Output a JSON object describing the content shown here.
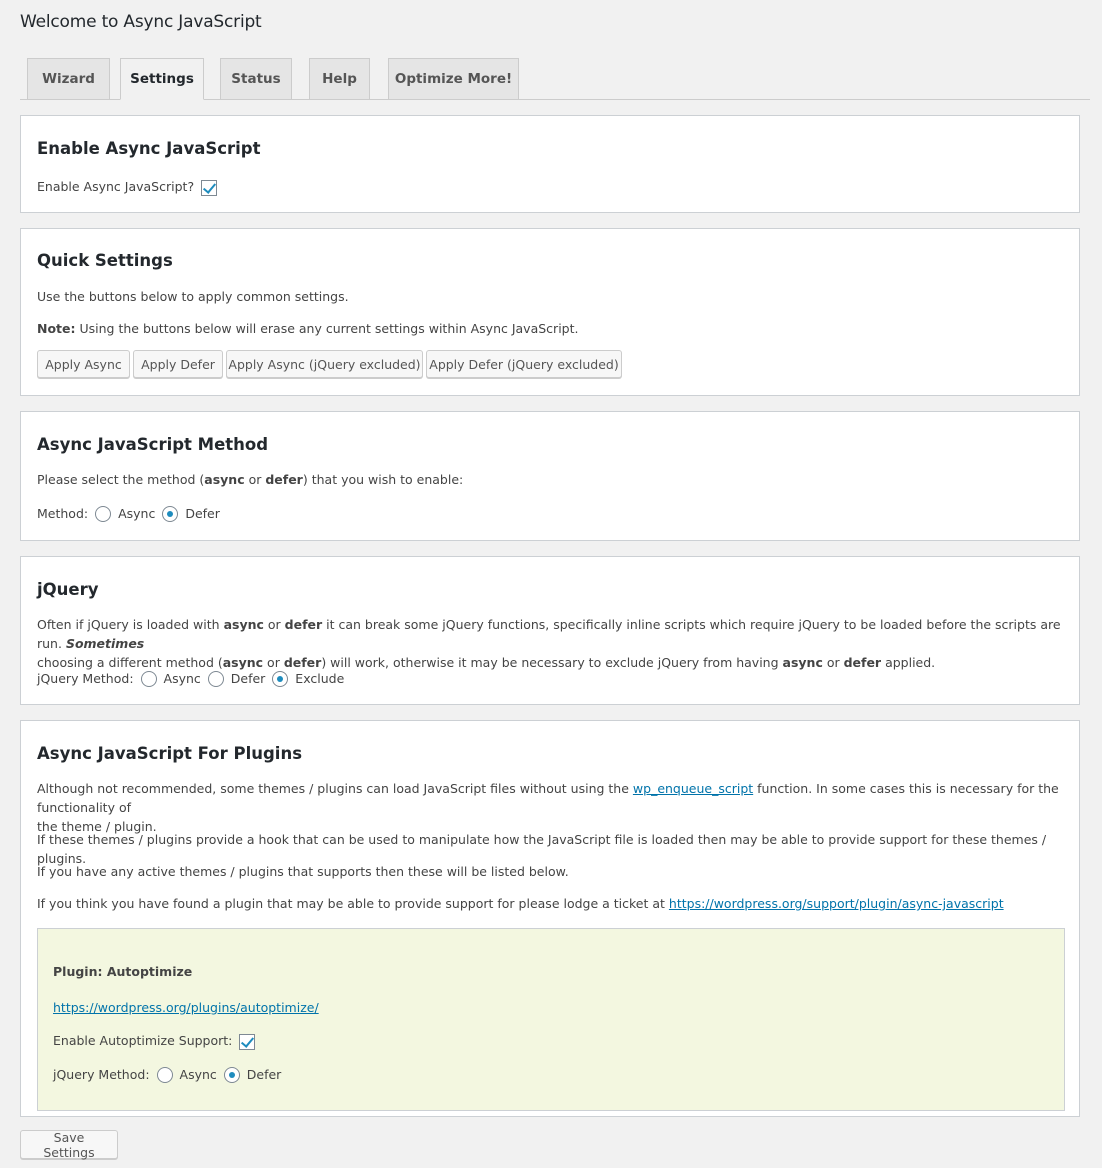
{
  "page_title": "Welcome to Async JavaScript",
  "tabs": [
    {
      "label": "Wizard",
      "active": false
    },
    {
      "label": "Settings",
      "active": true
    },
    {
      "label": "Status",
      "active": false
    },
    {
      "label": "Help",
      "active": false
    },
    {
      "label": "Optimize More!",
      "active": false
    }
  ],
  "enable_section": {
    "title": "Enable Async JavaScript",
    "checkbox_label": "Enable Async JavaScript?",
    "checked": true
  },
  "quick_settings": {
    "title": "Quick Settings",
    "intro": "Use the buttons below to apply common settings.",
    "note_label": "Note:",
    "note_text": " Using the buttons below will erase any current settings within Async JavaScript.",
    "buttons": [
      "Apply Async",
      "Apply Defer",
      "Apply Async (jQuery excluded)",
      "Apply Defer (jQuery excluded)"
    ]
  },
  "method_section": {
    "title": "Async JavaScript Method",
    "desc_pre": "Please select the method (",
    "desc_async": "async",
    "desc_or": " or ",
    "desc_defer": "defer",
    "desc_post": ") that you wish to enable:",
    "method_label": "Method:",
    "options": [
      "Async",
      "Defer"
    ],
    "selected": "Defer"
  },
  "jquery_section": {
    "title": "jQuery",
    "p1": "Often if jQuery is loaded with ",
    "p2": "async",
    "p3": " or ",
    "p4": "defer",
    "p5": " it can break some jQuery functions, specifically inline scripts which require jQuery to be loaded before the scripts are run. ",
    "p6": "Sometimes",
    "p7": "choosing a different method (",
    "p8": "async",
    "p9": " or ",
    "p10": "defer",
    "p11": ") will work, otherwise it may be necessary to exclude jQuery from having ",
    "p12": "async",
    "p13": " or ",
    "p14": "defer",
    "p15": " applied.",
    "method_label": "jQuery Method:",
    "options": [
      "Async",
      "Defer",
      "Exclude"
    ],
    "selected": "Exclude"
  },
  "plugins_section": {
    "title": "Async JavaScript For Plugins",
    "p1_pre": "Although not recommended, some themes / plugins can load JavaScript files without using the ",
    "p1_link": "wp_enqueue_script",
    "p1_post": " function. In some cases this is necessary for the functionality of",
    "p1_line2": "the theme / plugin.",
    "p2": "If these themes / plugins provide a hook that can be used to manipulate how the JavaScript file is loaded then may be able to provide support for these themes / plugins.",
    "p3": "If you have any active themes / plugins that supports then these will be listed below.",
    "p4_pre": "If you think you have found a plugin that may be able to provide support for please lodge a ticket at ",
    "p4_link": "https://wordpress.org/support/plugin/async-javascript",
    "plugin": {
      "title": "Plugin: Autoptimize",
      "link": "https://wordpress.org/plugins/autoptimize/",
      "support_label": "Enable Autoptimize Support:",
      "support_checked": true,
      "method_label": "jQuery Method:",
      "options": [
        "Async",
        "Defer"
      ],
      "selected": "Defer"
    }
  },
  "save_button": "Save Settings"
}
